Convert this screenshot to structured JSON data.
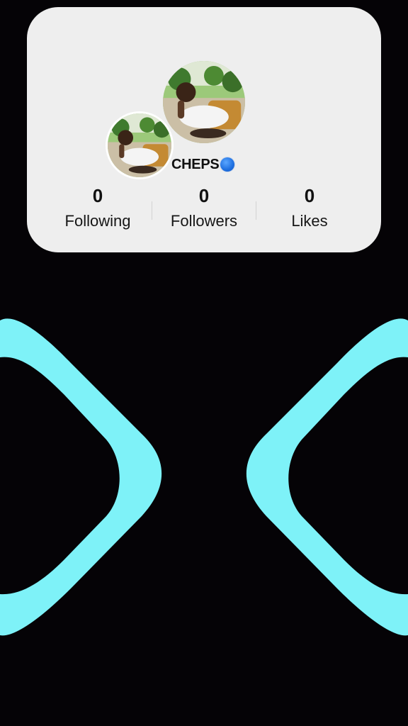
{
  "profile": {
    "username": "CHEPS",
    "verified_icon": "blue-circle-badge",
    "avatar_description_icon": "profile-photo"
  },
  "stats": {
    "following": {
      "value": "0",
      "label": "Following"
    },
    "followers": {
      "value": "0",
      "label": "Followers"
    },
    "likes": {
      "value": "0",
      "label": "Likes"
    }
  },
  "colors": {
    "background": "#050306",
    "card": "#eeeeee",
    "accent_shapes": "#7ef2f8",
    "verified": "#1e6fe0"
  }
}
